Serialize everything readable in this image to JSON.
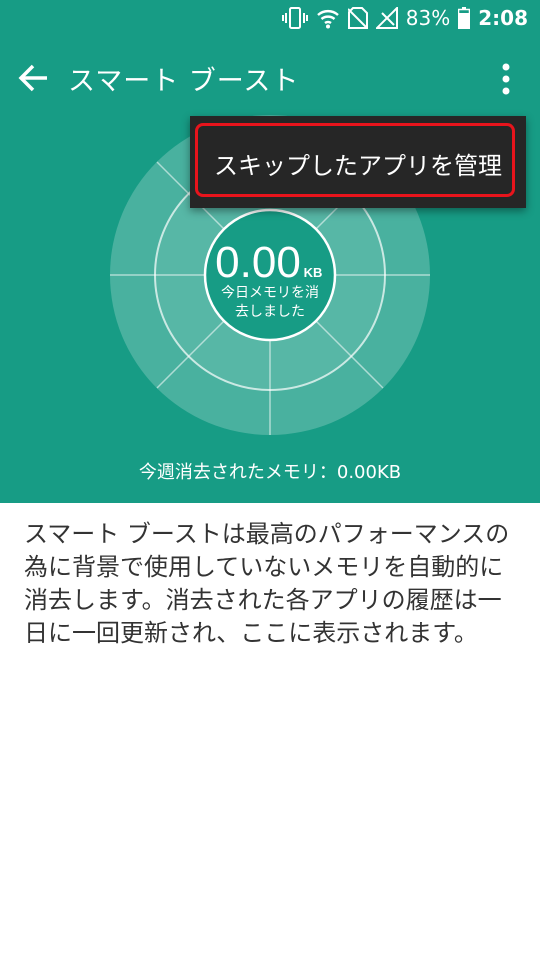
{
  "status_bar": {
    "battery_percent": "83%",
    "time": "2:08",
    "icons": [
      "vibrate-icon",
      "wifi-icon",
      "no-sim-icon",
      "signal-icon",
      "battery-icon"
    ]
  },
  "app_bar": {
    "title": "スマート ブースト",
    "back_icon": "arrow-back-icon",
    "menu_icon": "more-vert-icon"
  },
  "popup_menu": {
    "items": [
      {
        "label": "スキップしたアプリを管理"
      }
    ]
  },
  "gauge": {
    "value": "0.00",
    "unit": "KB",
    "caption_line1": "今日メモリを消",
    "caption_line2": "去しました"
  },
  "weekly_summary": "今週消去されたメモリ：0.00KB",
  "description": "スマート ブーストは最高のパフォーマンスの為に背景で使用していないメモリを自動的に消去します。消去された各アプリの履歴は一日に一回更新され、ここに表示されます。",
  "colors": {
    "header_bg": "#179c85",
    "menu_bg": "#262626",
    "highlight": "#e8141c"
  }
}
